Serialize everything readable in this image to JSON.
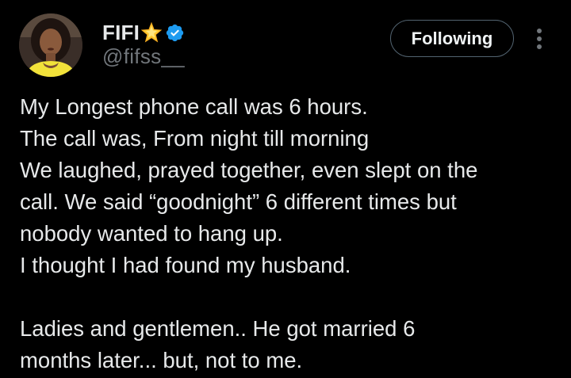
{
  "author": {
    "display_name": "FIFI",
    "handle": "@fifss__",
    "name_emoji_icon": "glowing-star-icon",
    "verified_icon": "verified-badge-icon",
    "verified_color": "#1d9bf0"
  },
  "actions": {
    "follow_label": "Following",
    "more_icon": "more-vertical-icon"
  },
  "tweet": {
    "lines": [
      "My Longest phone call was 6 hours.",
      "The call was, From night till morning",
      "We laughed, prayed together, even slept on the",
      "call.  We said “goodnight” 6 different times but",
      "nobody wanted to hang up.",
      "I thought I had found my husband.",
      "",
      "Ladies and gentlemen.. He got married 6",
      "months later... but, not to me."
    ]
  },
  "colors": {
    "background": "#000000",
    "text_primary": "#e7e9ea",
    "text_secondary": "#71767b",
    "button_border": "#536471"
  }
}
